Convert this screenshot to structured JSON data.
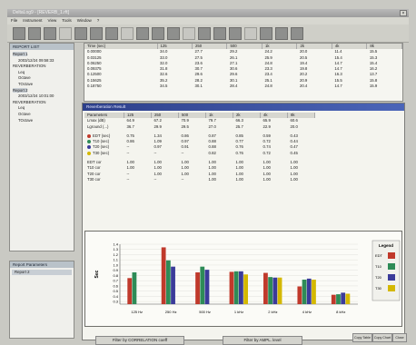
{
  "window": {
    "title": "DeltaLog9 - [REVERB_1.rft]"
  },
  "menu": [
    "File",
    "Instrument",
    "View",
    "Tools",
    "Window",
    "?"
  ],
  "toolbar": {
    "icons": [
      "new-icon",
      "open-icon",
      "save-icon",
      "cut-icon",
      "copy-icon",
      "paste-icon",
      "print-icon",
      "table-icon",
      "chart-icon",
      "grid-icon",
      "zoom-icon",
      "cursor-icon",
      "level-icon",
      "spectrum-icon",
      "reverb-icon",
      "filter-icon",
      "export-icon",
      "print2-icon",
      "help-icon"
    ]
  },
  "report_list": {
    "header": "REPORT LIST",
    "items": [
      {
        "label": "Report 1",
        "level": 0
      },
      {
        "label": "2003/12/24 09:58:33",
        "level": 1
      },
      {
        "label": "REVERBERATION",
        "level": 0
      },
      {
        "label": "Leq",
        "level": 1
      },
      {
        "label": "Octave",
        "level": 1
      },
      {
        "label": "TOctave",
        "level": 1
      },
      {
        "label": "Report 2",
        "level": 0
      },
      {
        "label": "2003/12/24 10:01:00",
        "level": 1
      },
      {
        "label": "REVERBERATION",
        "level": 0
      },
      {
        "label": "Leq",
        "level": 1
      },
      {
        "label": "Octave",
        "level": 1
      },
      {
        "label": "TOctave",
        "level": 1
      }
    ]
  },
  "report_parameters": {
    "header": "Report Parameters",
    "item": "Report 2"
  },
  "top_table": {
    "columns": [
      "Time (sec)",
      "125",
      "250",
      "500",
      "1k",
      "2k",
      "4k",
      "8k"
    ],
    "rows": [
      [
        "0.00000",
        "34.0",
        "27.7",
        "29.2",
        "24.2",
        "20.0",
        "11.4",
        "15.5"
      ],
      [
        "0.03125",
        "33.0",
        "27.5",
        "26.1",
        "25.9",
        "20.5",
        "15.4",
        "15.3"
      ],
      [
        "0.06250",
        "32.0",
        "23.6",
        "27.1",
        "24.8",
        "19.4",
        "14.7",
        "15.4"
      ],
      [
        "0.09375",
        "31.8",
        "30.7",
        "30.6",
        "23.3",
        "19.8",
        "14.7",
        "16.2"
      ],
      [
        "0.12500",
        "32.6",
        "29.6",
        "29.6",
        "23.4",
        "20.2",
        "16.3",
        "13.7"
      ],
      [
        "0.15625",
        "35.2",
        "28.2",
        "30.1",
        "25.1",
        "20.9",
        "15.5",
        "15.8"
      ],
      [
        "0.18750",
        "34.5",
        "30.1",
        "28.4",
        "24.8",
        "20.4",
        "14.7",
        "15.9"
      ]
    ]
  },
  "result_window": {
    "title": "Reverberation Result",
    "columns": [
      "Parameters",
      "125",
      "250",
      "500",
      "1k",
      "2k",
      "4k",
      "8k"
    ],
    "rows_a": [
      [
        "Lmax (dB)",
        "64.9",
        "67.2",
        "70.9",
        "79.7",
        "66.3",
        "65.9",
        "60.6"
      ],
      [
        "Lground (...)",
        "36.7",
        "29.9",
        "29.5",
        "27.0",
        "25.7",
        "22.9",
        "20.0"
      ]
    ],
    "rows_b": [
      {
        "label": "EDT (sec)",
        "color": "#c0392b",
        "values": [
          "0.75",
          "1.34",
          "0.86",
          "0.87",
          "0.85",
          "0.59",
          "0.43"
        ]
      },
      {
        "label": "T10 (sec)",
        "color": "#2e8b57",
        "values": [
          "0.86",
          "1.09",
          "0.97",
          "0.88",
          "0.77",
          "0.72",
          "0.44"
        ]
      },
      {
        "label": "T20 (sec)",
        "color": "#3b3b9a",
        "values": [
          "--",
          "0.97",
          "0.91",
          "0.88",
          "0.76",
          "0.74",
          "0.47"
        ]
      },
      {
        "label": "T30 (sec)",
        "color": "#d4b800",
        "values": [
          "--",
          "--",
          "--",
          "0.82",
          "0.76",
          "0.72",
          "0.45"
        ]
      }
    ],
    "rows_c": [
      [
        "EDT cor",
        "1.00",
        "1.00",
        "1.00",
        "1.00",
        "1.00",
        "1.00",
        "1.00"
      ],
      [
        "T10 cor",
        "1.00",
        "1.00",
        "1.00",
        "1.00",
        "1.00",
        "1.00",
        "1.00"
      ],
      [
        "T20 cor",
        "--",
        "1.00",
        "1.00",
        "1.00",
        "1.00",
        "1.00",
        "1.00"
      ],
      [
        "T30 cor",
        "--",
        "--",
        "--",
        "1.00",
        "1.00",
        "1.00",
        "1.00"
      ]
    ],
    "buttons": [
      "Filter by CORRELATION coeff",
      "Filter by AMPL. level"
    ],
    "corner_buttons": [
      "Copy Table",
      "Copy Chart",
      "Close"
    ]
  },
  "chart_data": {
    "type": "bar",
    "ylabel": "Sec",
    "ylim": [
      0,
      1.4
    ],
    "yticks": [
      "1.4",
      "1.3",
      "1.2",
      "1.1",
      "1.0",
      "0.9",
      "0.8",
      "0.7",
      "0.6",
      "0.5",
      "0.4",
      "0.3"
    ],
    "categories": [
      "125 Hz",
      "250 Hz",
      "500 Hz",
      "1 kHz",
      "2 kHz",
      "4 kHz",
      "8 kHz"
    ],
    "legend_title": "Legend",
    "legend_position": "right",
    "series": [
      {
        "name": "EDT",
        "color": "#c0392b",
        "values": [
          0.75,
          1.34,
          0.86,
          0.87,
          0.85,
          0.59,
          0.43
        ]
      },
      {
        "name": "T10",
        "color": "#2e8b57",
        "values": [
          0.86,
          1.09,
          0.97,
          0.88,
          0.77,
          0.72,
          0.44
        ]
      },
      {
        "name": "T20",
        "color": "#3b3b9a",
        "values": [
          null,
          0.97,
          0.91,
          0.88,
          0.76,
          0.74,
          0.47
        ]
      },
      {
        "name": "T30",
        "color": "#d4b800",
        "values": [
          null,
          null,
          null,
          0.82,
          0.76,
          0.72,
          0.45
        ]
      }
    ]
  }
}
